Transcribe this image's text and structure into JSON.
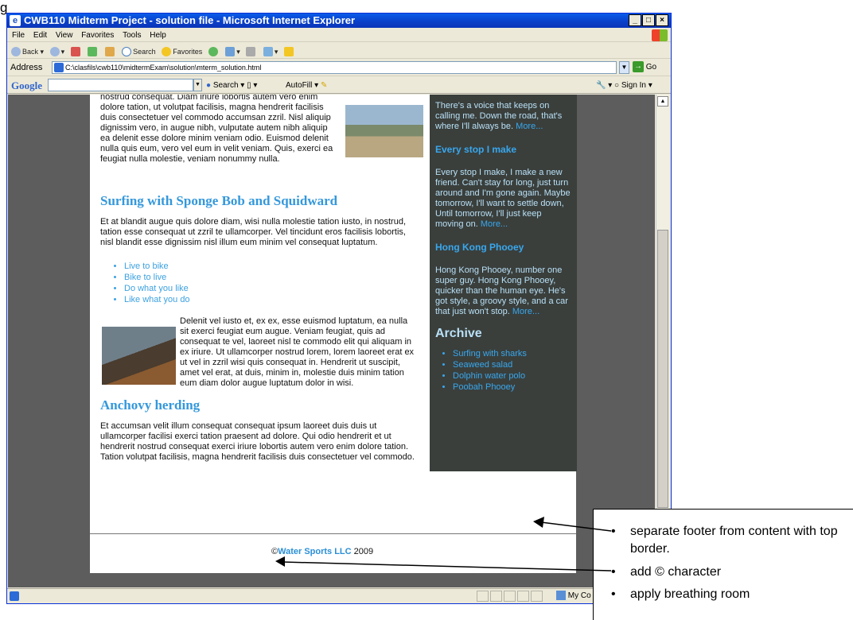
{
  "figure_label": "g",
  "window": {
    "title": "CWB110 Midterm Project - solution file - Microsoft Internet Explorer",
    "controls": [
      "_",
      "□",
      "×"
    ]
  },
  "menu": [
    "File",
    "Edit",
    "View",
    "Favorites",
    "Tools",
    "Help"
  ],
  "toolbar": {
    "back": "Back",
    "search": "Search",
    "favorites": "Favorites"
  },
  "address": {
    "label": "Address",
    "url": "C:\\clasfils\\cwb110\\midtermExam\\solution\\mterm_solution.html",
    "go": "Go"
  },
  "google_bar": {
    "logo": "Google",
    "search": "Search",
    "autofill": "AutoFill",
    "sign_in": "Sign In"
  },
  "main": {
    "intro_text": "nostrud consequat. Diam iriure lobortis autem vero enim dolore tation, ut volutpat facilisis, magna hendrerit facilisis duis consectetuer vel commodo accumsan zzril. Nisl aliquip dignissim vero, in augue nibh, vulputate autem nibh aliquip ea delenit esse dolore minim veniam odio. Euismod delenit nulla quis eum, vero vel eum in velit veniam. Quis, exerci ea feugiat nulla molestie, veniam nonummy nulla.",
    "heading1": "Surfing with Sponge Bob and Squidward",
    "para1": "Et at blandit augue quis dolore diam, wisi nulla molestie tation iusto, in nostrud, tation esse consequat ut zzril te ullamcorper. Vel tincidunt eros facilisis lobortis, nisl blandit esse dignissim nisl illum eum minim vel consequat luptatum.",
    "links": [
      "Live to bike",
      "Bike to live",
      "Do what you like",
      "Like what you do"
    ],
    "para2": "Delenit vel iusto et, ex ex, esse euismod luptatum, ea nulla sit exerci feugiat eum augue. Veniam feugiat, quis ad consequat te vel, laoreet nisl te commodo elit qui aliquam in ex iriure. Ut ullamcorper nostrud lorem, lorem laoreet erat ex ut vel in zzril wisi quis consequat in. Hendrerit ut suscipit, amet vel erat, at duis, minim in, molestie duis minim tation eum diam dolor augue luptatum dolor in wisi.",
    "heading2": "Anchovy herding",
    "para3": "Et accumsan velit illum consequat consequat ipsum laoreet duis duis ut ullamcorper facilisi exerci tation praesent ad dolore. Qui odio hendrerit et ut hendrerit nostrud consequat exerci iriure lobortis autem vero enim dolore tation. Tation volutpat facilisis, magna hendrerit facilisis duis consectetuer vel commodo."
  },
  "sidebar": {
    "intro": "There's a voice that keeps on calling me. Down the road, that's where I'll always be.",
    "intro_more": "More...",
    "h1": "Every stop I make",
    "p1": "Every stop I make, I make a new friend. Can't stay for long, just turn around and I'm gone again. Maybe tomorrow, I'll want to settle down, Until tomorrow, I'll just keep moving on.",
    "p1_more": "More...",
    "h2": "Hong Kong Phooey",
    "p2": "Hong Kong Phooey, number one super guy. Hong Kong Phooey, quicker than the human eye. He's got style, a groovy style, and a car that just won't stop.",
    "p2_more": "More...",
    "archive_title": "Archive",
    "archive": [
      "Surfing with sharks",
      "Seaweed salad",
      "Dolphin water polo",
      "Poobah Phooey"
    ]
  },
  "footer": {
    "copyright": "©",
    "brand": "Water Sports LLC",
    "year": "2009"
  },
  "status": {
    "zone": "My Co"
  },
  "annotations": {
    "item0": "separate footer from content with top border.",
    "item1": "add © character",
    "item2": "apply breathing room"
  },
  "colors": {
    "link_blue": "#3498db",
    "sidebar_bg": "#3a3f3c",
    "viewport_bg": "#5d5d5d"
  }
}
